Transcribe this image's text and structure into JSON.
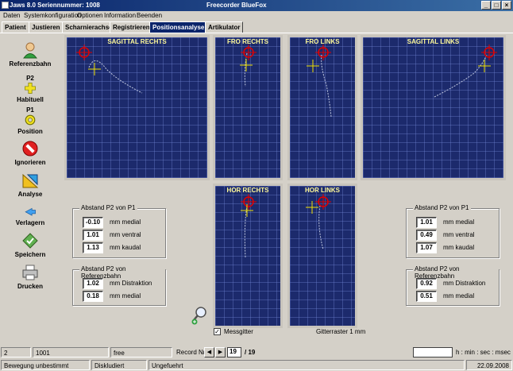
{
  "window": {
    "title": "Jaws 8.0   Seriennummer: 1008",
    "subtitle": "Freecorder BlueFox",
    "min": "_",
    "max": "□",
    "close": "×"
  },
  "menu": [
    "Daten",
    "Systemkonfiguration",
    "Optionen",
    "Information",
    "Beenden"
  ],
  "tabs": [
    "Patient",
    "Justieren",
    "Scharnierachse",
    "Registrieren",
    "Positionsanalyse",
    "Artikulator"
  ],
  "active_tab": "Positionsanalyse",
  "sidebar": [
    {
      "label": "Referenzbahn",
      "sub": "",
      "icon": "person-icon"
    },
    {
      "label": "Habituell",
      "sub": "P2",
      "icon": "cross-plus-icon"
    },
    {
      "label": "Position",
      "sub": "P1",
      "icon": "ring-icon"
    },
    {
      "label": "Ignorieren",
      "sub": "",
      "icon": "no-entry-icon"
    },
    {
      "label": "Analyse",
      "sub": "",
      "icon": "ruler-triangle-icon"
    },
    {
      "label": "Verlagern",
      "sub": "",
      "icon": "arrow-icon"
    },
    {
      "label": "Speichern",
      "sub": "",
      "icon": "save-icon"
    },
    {
      "label": "Drucken",
      "sub": "",
      "icon": "printer-icon"
    }
  ],
  "panels": {
    "sagittal_rechts": "SAGITTAL RECHTS",
    "fro_rechts": "FRO RECHTS",
    "fro_links": "FRO LINKS",
    "sagittal_links": "SAGITTAL LINKS",
    "hor_rechts": "HOR RECHTS",
    "hor_links": "HOR LINKS"
  },
  "left_group1": {
    "title": "Abstand P2 von P1",
    "rows": [
      {
        "value": "-0.10",
        "label": "mm medial"
      },
      {
        "value": "1.01",
        "label": "mm ventral"
      },
      {
        "value": "1.13",
        "label": "mm kaudal"
      }
    ]
  },
  "left_group2": {
    "title": "Abstand P2 von Referenzbahn",
    "rows": [
      {
        "value": "1.02",
        "label": "mm Distraktion"
      },
      {
        "value": "0.18",
        "label": "mm medial"
      }
    ]
  },
  "right_group1": {
    "title": "Abstand P2 von P1",
    "rows": [
      {
        "value": "1.01",
        "label": "mm medial"
      },
      {
        "value": "0.49",
        "label": "mm ventral"
      },
      {
        "value": "1.07",
        "label": "mm kaudal"
      }
    ]
  },
  "right_group2": {
    "title": "Abstand P2 von Referenzbahn",
    "rows": [
      {
        "value": "0.92",
        "label": "mm Distraktion"
      },
      {
        "value": "0.51",
        "label": "mm medial"
      }
    ]
  },
  "messgitter": {
    "label": "Messgitter",
    "checked": true
  },
  "gitterraster": "Gitterraster 1 mm",
  "status": {
    "c1": "2",
    "c2": "1001",
    "c3": "free",
    "record_label": "Record Nr.",
    "record_current": "19",
    "record_total": "/ 19",
    "time_format": "h : min : sec : msec",
    "bottom1": "Bewegung unbestimmt",
    "bottom2": "Diskludiert",
    "bottom3": "Ungefuehrt",
    "date": "22.09.2008"
  }
}
